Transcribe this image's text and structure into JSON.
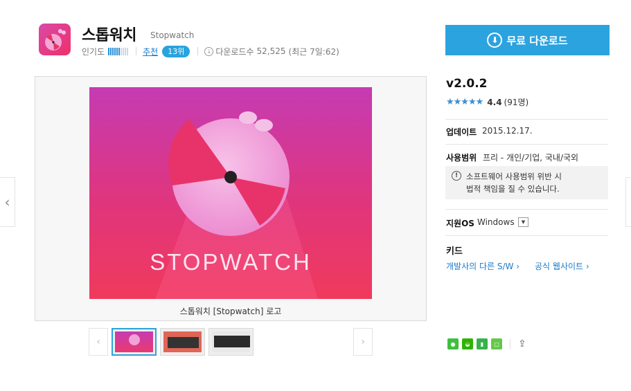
{
  "app": {
    "title": "스톱워치",
    "subtitle": "Stopwatch",
    "popularity_label": "인기도",
    "popularity_level": 0.6,
    "recommend_label": "추천",
    "rank": "13위",
    "download_label": "다운로드수",
    "download_count": "52,525",
    "recent_downloads": "(최근 7일:62)"
  },
  "preview": {
    "image_text": "STOPWATCH",
    "caption": "스톱워치 [Stopwatch] 로고",
    "prev_arrow": "‹",
    "next_arrow": "›",
    "thumb_prev": "‹",
    "thumb_next": "›"
  },
  "sidebar": {
    "download_button": "무료 다운로드",
    "version": "v2.0.2",
    "stars": "★★★★★",
    "rating_score": "4.4",
    "rating_count": "(91명)",
    "update_label": "업데이트",
    "update_value": "2015.12.17.",
    "usage_label": "사용범위",
    "usage_value": "프리 - 개인/기업, 국내/국외",
    "notice_icon": "!",
    "notice_line1": "소프트웨어 사용범위 위반 시",
    "notice_line2": "법적 책임을 질 수 있습니다.",
    "os_label": "지원OS",
    "os_value": "Windows",
    "os_dropdown": "▼",
    "code_label": "키드",
    "link_dev": "개발사의 다른 S/W ›",
    "link_site": "공식 웹사이트 ›"
  },
  "colors": {
    "accent": "#2ba3df",
    "link": "#1a7ac9",
    "pink": "#e43a8c"
  },
  "icons": [
    "app-stopwatch-icon",
    "download-circle-icon",
    "notice-icon",
    "share-icon"
  ]
}
